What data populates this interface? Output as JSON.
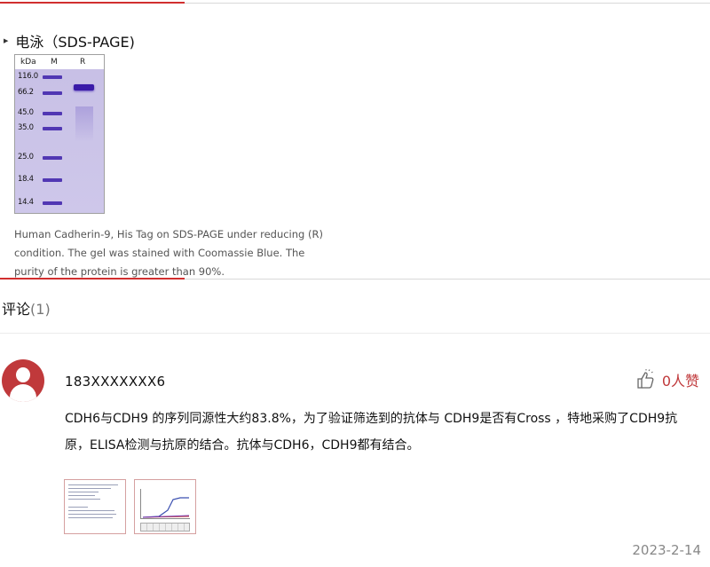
{
  "section": {
    "title": "电泳（SDS-PAGE)"
  },
  "gel": {
    "header": {
      "kda": "kDa",
      "marker": "M",
      "reduced": "R"
    },
    "markers": [
      "116.0",
      "66.2",
      "45.0",
      "35.0",
      "25.0",
      "18.4",
      "14.4"
    ]
  },
  "caption": {
    "line1": "Human Cadherin-9, His Tag on SDS-PAGE under reducing (R)",
    "line2": "condition. The gel was stained with Coomassie Blue. The",
    "line3": "purity of the protein is greater than 90%."
  },
  "comments": {
    "title": "评论",
    "count": "(1)"
  },
  "comment": {
    "username": "183XXXXXXX6",
    "likes": "0人赞",
    "line1": "CDH6与CDH9 的序列同源性大约83.8%，为了验证筛选到的抗体与 CDH9是否有Cross ，特地采购了CDH9抗",
    "line2": "原，ELISA检测与抗原的结合。抗体与CDH6，CDH9都有结合。",
    "date": "2023-2-14"
  },
  "colors": {
    "accent": "#d12f2f",
    "avatar": "#c0393b",
    "gel": "#c8c0e6",
    "band": "#4a2fb0"
  },
  "icons": {
    "like": "thumbs-up-icon",
    "avatar": "user-icon",
    "bullet": "triangle-right-icon"
  }
}
